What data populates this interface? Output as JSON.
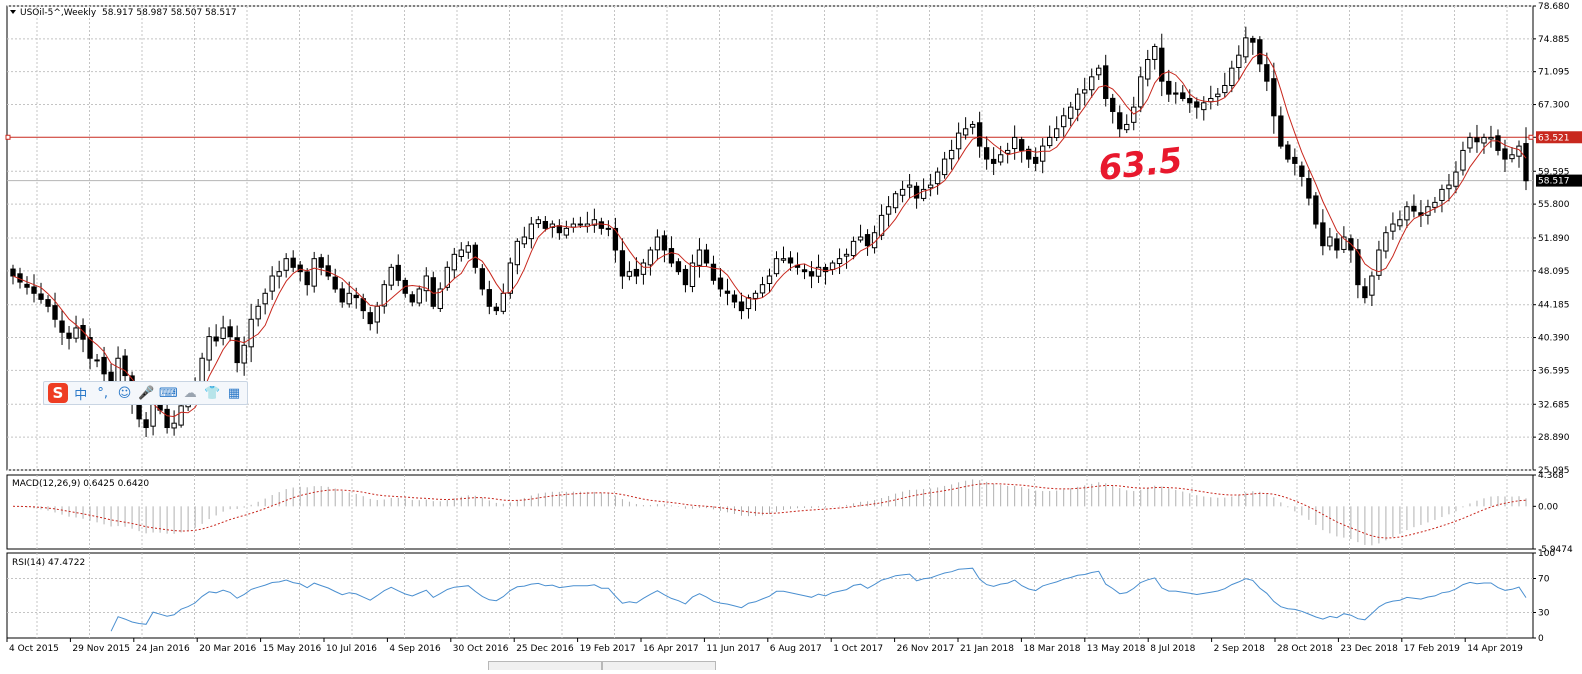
{
  "header": {
    "symbol_line": "USOil-5^,Weekly",
    "ohlc": "58.917 58.987 58.507 58.517"
  },
  "annotation": {
    "text": "63.5",
    "color": "#e8182d"
  },
  "colors": {
    "grid": "#c4c4c4",
    "ma_line": "#c8281e",
    "hline": "#c8281e",
    "bull_body": "#ffffff",
    "bear_body": "#000000",
    "macd_hist": "#b0b0b0",
    "macd_signal": "#c8281e",
    "rsi_line": "#4a8fd0",
    "price_label_bg": "#c8281e"
  },
  "chart_data": [
    {
      "type": "candlestick",
      "title": "USOil-5^,Weekly",
      "ylim": [
        25.095,
        78.68
      ],
      "y_ticks": [
        "78.680",
        "74.885",
        "71.095",
        "67.300",
        "63.521",
        "59.595",
        "55.800",
        "51.890",
        "48.095",
        "44.185",
        "40.390",
        "36.595",
        "32.685",
        "28.890",
        "25.095"
      ],
      "horizontal_line": {
        "value": 63.521,
        "label": "63.521"
      },
      "current_price": {
        "value": 58.517,
        "label": "58.517"
      },
      "x_labels": [
        "4 Oct 2015",
        "29 Nov 2015",
        "24 Jan 2016",
        "20 Mar 2016",
        "15 May 2016",
        "10 Jul 2016",
        "4 Sep 2016",
        "30 Oct 2016",
        "25 Dec 2016",
        "19 Feb 2017",
        "16 Apr 2017",
        "11 Jun 2017",
        "6 Aug 2017",
        "1 Oct 2017",
        "26 Nov 2017",
        "21 Jan 2018",
        "18 Mar 2018",
        "13 May 2018",
        "8 Jul 2018",
        "2 Sep 2018",
        "28 Oct 2018",
        "23 Dec 2018",
        "17 Feb 2019",
        "14 Apr 2019"
      ],
      "close": [
        47.5,
        46.8,
        46.2,
        45.5,
        44.8,
        44.0,
        42.5,
        41.0,
        40.3,
        41.5,
        40.2,
        38.0,
        37.8,
        36.2,
        34.8,
        38.0,
        36.0,
        33.0,
        31.0,
        30.0,
        33.8,
        32.0,
        30.0,
        30.5,
        32.5,
        33.5,
        35.0,
        38.0,
        40.5,
        40.0,
        41.5,
        40.5,
        37.5,
        39.5,
        42.5,
        44.0,
        45.5,
        47.5,
        48.0,
        49.5,
        48.5,
        48.0,
        46.5,
        49.5,
        48.5,
        47.5,
        46.0,
        44.5,
        45.5,
        45.0,
        43.5,
        42.0,
        44.0,
        46.5,
        48.5,
        47.0,
        45.5,
        44.5,
        46.0,
        47.5,
        44.0,
        46.0,
        48.5,
        50.0,
        50.5,
        51.0,
        48.5,
        46.0,
        44.0,
        43.5,
        45.5,
        49.0,
        51.5,
        52.0,
        53.5,
        54.0,
        53.0,
        53.5,
        52.5,
        53.0,
        53.5,
        53.5,
        53.5,
        54.0,
        53.0,
        53.0,
        50.5,
        47.5,
        48.0,
        47.5,
        49.0,
        50.5,
        52.0,
        50.5,
        49.0,
        48.0,
        46.5,
        49.0,
        50.5,
        49.0,
        47.0,
        46.0,
        45.5,
        44.5,
        43.5,
        45.0,
        45.5,
        46.5,
        47.5,
        49.5,
        49.5,
        49.0,
        48.5,
        48.0,
        47.5,
        48.5,
        48.0,
        49.0,
        49.5,
        50.0,
        51.5,
        52.0,
        51.0,
        52.5,
        54.5,
        55.5,
        57.0,
        57.5,
        58.0,
        56.5,
        57.5,
        58.0,
        59.5,
        61.0,
        62.0,
        64.0,
        64.5,
        65.0,
        62.5,
        61.0,
        60.5,
        61.5,
        62.0,
        63.5,
        62.0,
        61.0,
        60.5,
        62.5,
        63.5,
        64.5,
        66.0,
        67.0,
        68.5,
        69.0,
        70.5,
        71.5,
        68.0,
        66.5,
        64.5,
        65.0,
        67.0,
        70.5,
        72.5,
        74.0,
        70.0,
        68.5,
        68.5,
        68.0,
        67.5,
        67.0,
        67.5,
        68.0,
        68.5,
        69.5,
        71.5,
        73.0,
        75.0,
        74.5,
        72.0,
        70.0,
        66.0,
        62.5,
        61.0,
        60.5,
        59.0,
        56.5,
        53.5,
        51.0,
        52.0,
        50.5,
        52.0,
        50.5,
        46.5,
        45.0,
        47.5,
        50.5,
        52.5,
        53.5,
        54.0,
        55.5,
        55.0,
        54.5,
        55.5,
        56.0,
        57.5,
        58.0,
        59.5,
        62.0,
        63.5,
        63.0,
        63.5,
        63.5,
        62.0,
        61.0,
        61.5,
        62.5,
        58.5
      ],
      "series": [
        {
          "name": "MA",
          "kind": "line"
        }
      ]
    },
    {
      "type": "histogram+line",
      "title": "MACD(12,26,9) 0.6425 0.6420",
      "ylim": [
        -5.9474,
        4.368
      ],
      "y_ticks": [
        "4.368",
        "0.00",
        "-5.9474"
      ],
      "source": "derived from close series"
    },
    {
      "type": "line",
      "title": "RSI(14) 47.4722",
      "ylim": [
        0,
        100
      ],
      "y_ticks": [
        "100",
        "70",
        "30",
        "0"
      ],
      "source": "derived from close series"
    }
  ]
}
